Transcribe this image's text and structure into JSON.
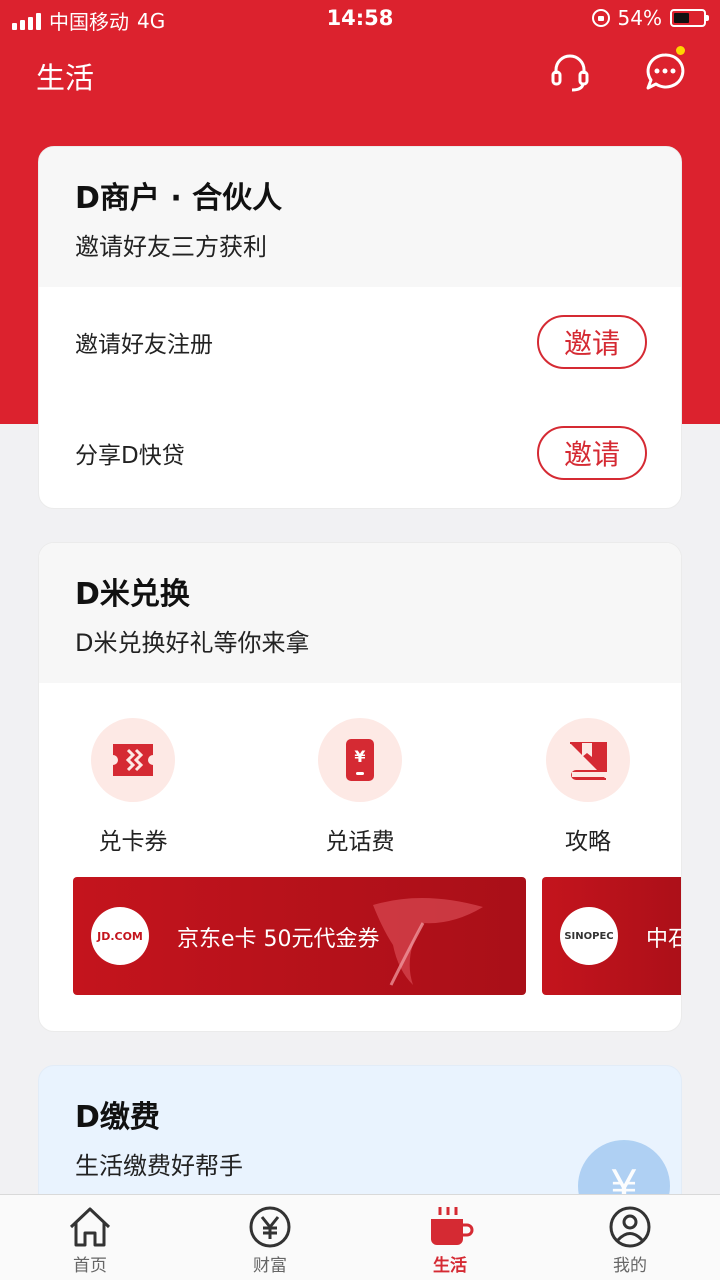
{
  "status_bar": {
    "carrier": "中国移动",
    "network": "4G",
    "time": "14:58",
    "battery": "54%"
  },
  "header": {
    "title": "生活",
    "icons": [
      "headset-icon",
      "message-icon"
    ]
  },
  "partner_card": {
    "title": "D商户 · 合伙人",
    "subtitle": "邀请好友三方获利",
    "rows": [
      {
        "label": "邀请好友注册",
        "button": "邀请"
      },
      {
        "label": "分享D快贷",
        "button": "邀请"
      }
    ]
  },
  "dmi_card": {
    "title": "D米兑换",
    "subtitle": "D米兑换好礼等你来拿",
    "items": [
      {
        "label": "兑卡券",
        "icon": "ticket-icon"
      },
      {
        "label": "兑话费",
        "icon": "phone-bill-icon"
      },
      {
        "label": "攻略",
        "icon": "book-icon"
      }
    ],
    "banners": [
      {
        "logo": "JD.COM",
        "text": "京东e卡 50元代金券"
      },
      {
        "logo": "SINOPEC",
        "text": "中石"
      }
    ]
  },
  "fee_card": {
    "title": "D缴费",
    "subtitle": "生活缴费好帮手",
    "badge": "¥"
  },
  "tabbar": {
    "tabs": [
      {
        "label": "首页",
        "icon": "home-icon"
      },
      {
        "label": "财富",
        "icon": "yen-icon"
      },
      {
        "label": "生活",
        "icon": "coffee-icon",
        "active": true
      },
      {
        "label": "我的",
        "icon": "user-icon"
      }
    ]
  },
  "colors": {
    "brand_red": "#dc222e",
    "accent_red": "#d52a33",
    "notification_dot": "#ffd400"
  }
}
